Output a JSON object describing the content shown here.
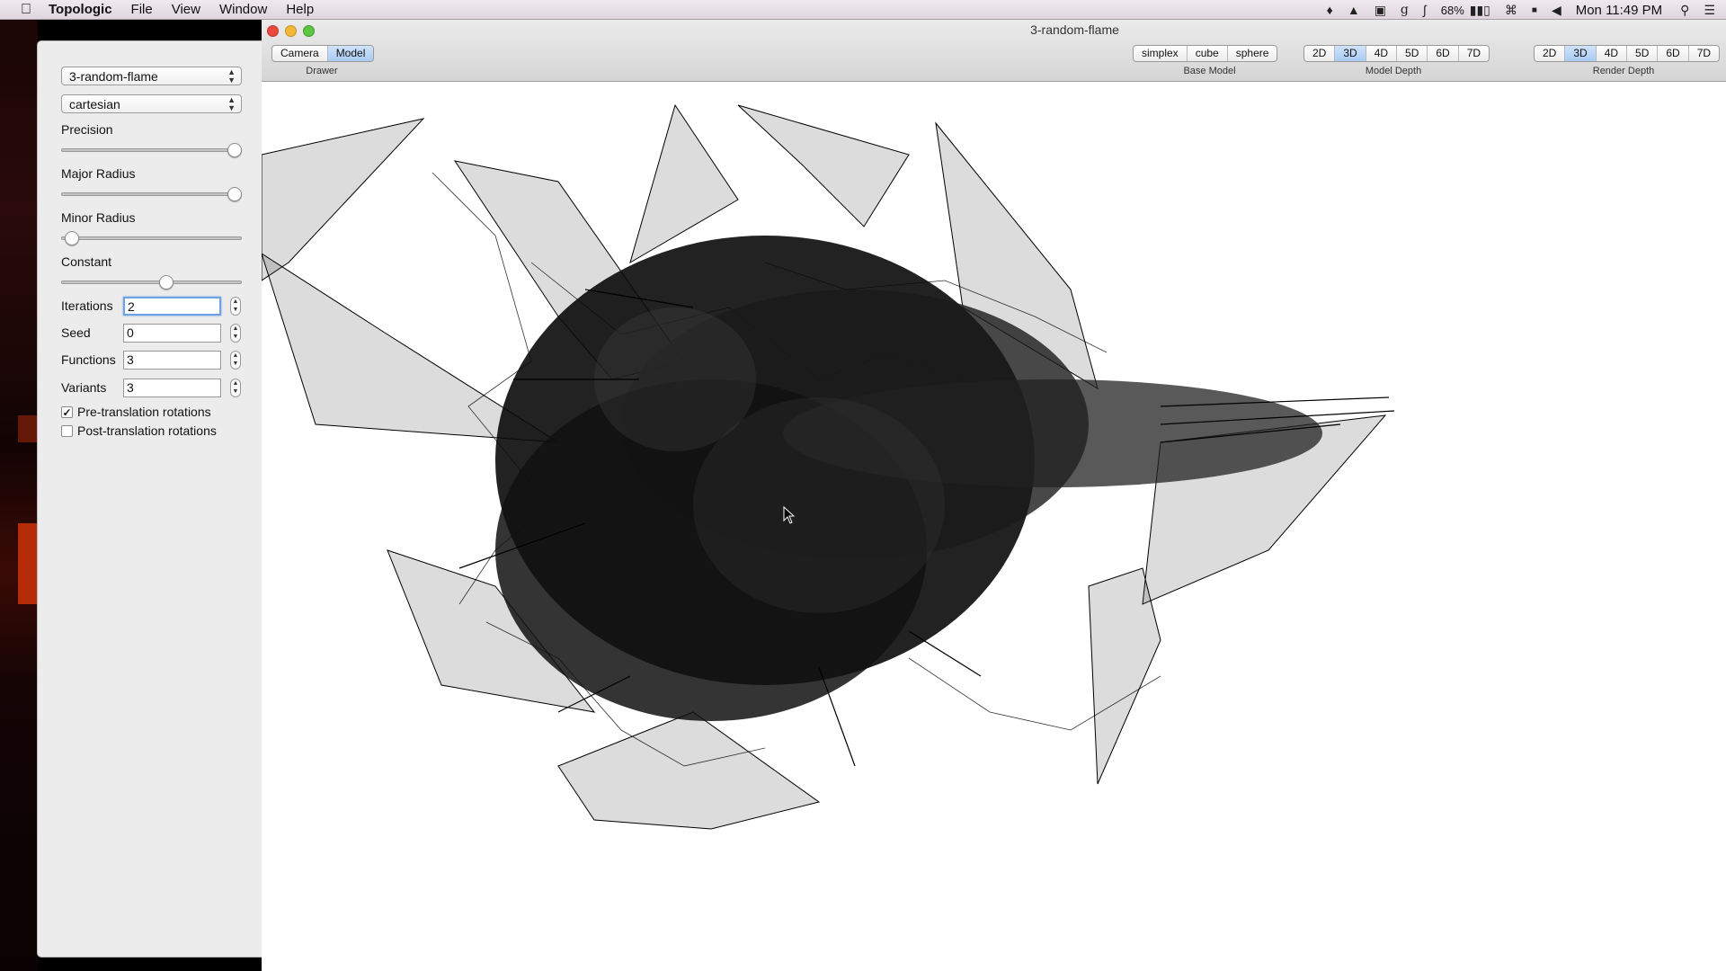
{
  "menubar": {
    "app_name": "Topologic",
    "items": [
      "File",
      "View",
      "Window",
      "Help"
    ],
    "battery": "68%",
    "clock": "Mon 11:49 PM",
    "icons": [
      "notification-icon",
      "google-drive-icon",
      "briefcase-icon",
      "google-icon",
      "bluetooth-icon",
      "battery-icon",
      "wifi-icon",
      "flag-icon",
      "volume-icon",
      "spotlight-icon",
      "notification-center-icon"
    ]
  },
  "panel": {
    "model_select": "3-random-flame",
    "coordinate_select": "cartesian",
    "sliders": [
      {
        "label": "Precision",
        "value": 1.0
      },
      {
        "label": "Major Radius",
        "value": 1.0
      },
      {
        "label": "Minor Radius",
        "value": 0.05
      },
      {
        "label": "Constant",
        "value": 0.58
      }
    ],
    "fields": [
      {
        "label": "Iterations",
        "value": "2"
      },
      {
        "label": "Seed",
        "value": "0"
      },
      {
        "label": "Functions",
        "value": "3"
      },
      {
        "label": "Variants",
        "value": "3"
      }
    ],
    "checkboxes": [
      {
        "label": "Pre-translation rotations",
        "checked": true
      },
      {
        "label": "Post-translation rotations",
        "checked": false
      }
    ]
  },
  "window": {
    "title": "3-random-flame",
    "drawer": {
      "label": "Drawer",
      "options": [
        "Camera",
        "Model"
      ],
      "selected": "Model"
    },
    "base_model": {
      "label": "Base Model",
      "options": [
        "simplex",
        "cube",
        "sphere"
      ],
      "selected": ""
    },
    "model_depth": {
      "label": "Model Depth",
      "options": [
        "2D",
        "3D",
        "4D",
        "5D",
        "6D",
        "7D"
      ],
      "selected": "3D"
    },
    "render_depth": {
      "label": "Render Depth",
      "options": [
        "2D",
        "3D",
        "4D",
        "5D",
        "6D",
        "7D"
      ],
      "selected": "3D"
    }
  }
}
